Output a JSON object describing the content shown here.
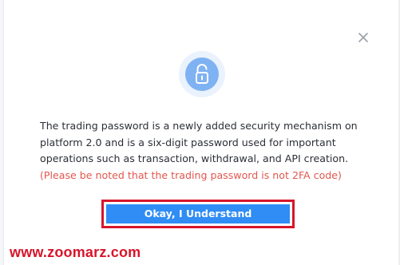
{
  "dialog": {
    "close_icon": "close-icon",
    "lock_icon": "unlocked-padlock-icon",
    "message_main": "The trading password is a newly added security mechanism on platform 2.0 and is a six-digit password used for important operations such as transaction, withdrawal, and API creation.",
    "message_warning": "(Please be noted that the trading password is not 2FA code)",
    "confirm_button_label": "Okay, I Understand"
  },
  "watermark": {
    "text": "www.zoomarz.com"
  },
  "colors": {
    "primary_button": "#2f8df5",
    "warning_text": "#e2574f",
    "highlight_border": "#d7152a",
    "icon_circle": "#7fb2f2",
    "icon_halo": "#eaf2fd"
  }
}
